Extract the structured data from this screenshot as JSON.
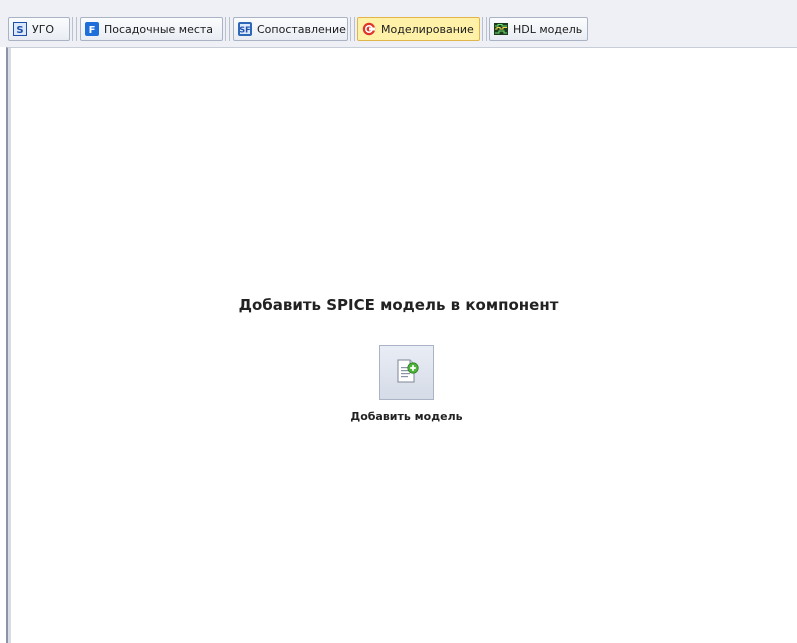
{
  "tabs": [
    {
      "label": "УГО",
      "icon": "symbol-s-icon",
      "active": false
    },
    {
      "label": "Посадочные места",
      "icon": "footprint-f-icon",
      "active": false
    },
    {
      "label": "Сопоставление",
      "icon": "mapping-icon",
      "active": false
    },
    {
      "label": "Моделирование",
      "icon": "simulation-icon",
      "active": true
    },
    {
      "label": "HDL модель",
      "icon": "hdl-model-icon",
      "active": false
    }
  ],
  "main": {
    "heading": "Добавить SPICE модель в компонент",
    "add_button_label": "Добавить модель"
  },
  "colors": {
    "active_tab": "#fff1a8",
    "tab_border": "#a9b3c4",
    "accent_blue": "#1e6fd9",
    "accent_red": "#e0342a",
    "add_green": "#4fb43a"
  }
}
